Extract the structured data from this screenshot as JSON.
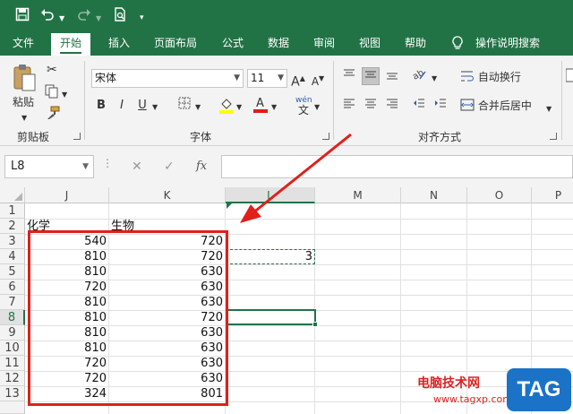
{
  "quick_access": {
    "save_icon": "save-icon",
    "undo_icon": "undo-icon",
    "redo_icon": "redo-icon",
    "preview_icon": "print-preview-icon",
    "customize_icon": "customize-qat-icon"
  },
  "tabs": [
    {
      "label": "文件"
    },
    {
      "label": "开始"
    },
    {
      "label": "插入"
    },
    {
      "label": "页面布局"
    },
    {
      "label": "公式"
    },
    {
      "label": "数据"
    },
    {
      "label": "审阅"
    },
    {
      "label": "视图"
    },
    {
      "label": "帮助"
    },
    {
      "label": "操作说明搜索"
    }
  ],
  "ribbon": {
    "clipboard": {
      "paste_label": "粘贴",
      "group_label": "剪贴板"
    },
    "font": {
      "font_name": "宋体",
      "font_size": "11",
      "bold": "B",
      "italic": "I",
      "underline": "U",
      "phonetic": "wén",
      "phonetic_sub": "文",
      "group_label": "字体"
    },
    "alignment": {
      "wrap_text": "自动换行",
      "merge_center": "合并后居中",
      "group_label": "对齐方式"
    },
    "accent_color": "#217346"
  },
  "formula_bar": {
    "name_box": "L8",
    "cancel": "✕",
    "enter": "✓",
    "fx": "fx",
    "formula": ""
  },
  "columns": [
    "J",
    "K",
    "L",
    "M",
    "N",
    "O",
    "P"
  ],
  "rows": [
    "1",
    "2",
    "3",
    "4",
    "5",
    "6",
    "7",
    "8",
    "9",
    "10",
    "11",
    "12",
    "13"
  ],
  "sheet": {
    "header_j": "化学",
    "header_k": "生物",
    "data": [
      {
        "row": "3",
        "j": "540",
        "k": "720"
      },
      {
        "row": "4",
        "j": "810",
        "k": "720",
        "l": "3"
      },
      {
        "row": "5",
        "j": "810",
        "k": "630"
      },
      {
        "row": "6",
        "j": "720",
        "k": "630"
      },
      {
        "row": "7",
        "j": "810",
        "k": "630"
      },
      {
        "row": "8",
        "j": "810",
        "k": "720"
      },
      {
        "row": "9",
        "j": "810",
        "k": "630"
      },
      {
        "row": "10",
        "j": "810",
        "k": "630"
      },
      {
        "row": "11",
        "j": "720",
        "k": "630"
      },
      {
        "row": "12",
        "j": "720",
        "k": "630"
      },
      {
        "row": "13",
        "j": "324",
        "k": "801"
      }
    ]
  },
  "annotation": {
    "box_color": "#e0201b",
    "arrow_color": "#e0201b"
  },
  "watermark": {
    "text": "电脑技术网",
    "url": "www.tagxp.com",
    "tag": "TAG"
  }
}
